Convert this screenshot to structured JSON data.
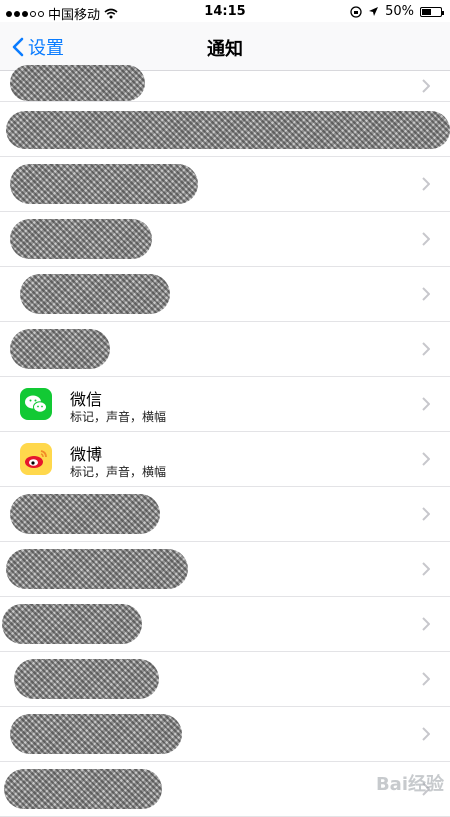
{
  "status_bar": {
    "carrier": "中国移动",
    "time": "14:15",
    "battery": "50%",
    "battery_level": 0.5
  },
  "nav": {
    "back_label": "设置",
    "title": "通知"
  },
  "apps": [
    {
      "name": "微信",
      "subtitle": "标记，声音，横幅",
      "icon": "wechat-icon"
    },
    {
      "name": "微博",
      "subtitle": "标记，声音，横幅",
      "icon": "weibo-icon"
    }
  ],
  "watermark": "Bai经验"
}
